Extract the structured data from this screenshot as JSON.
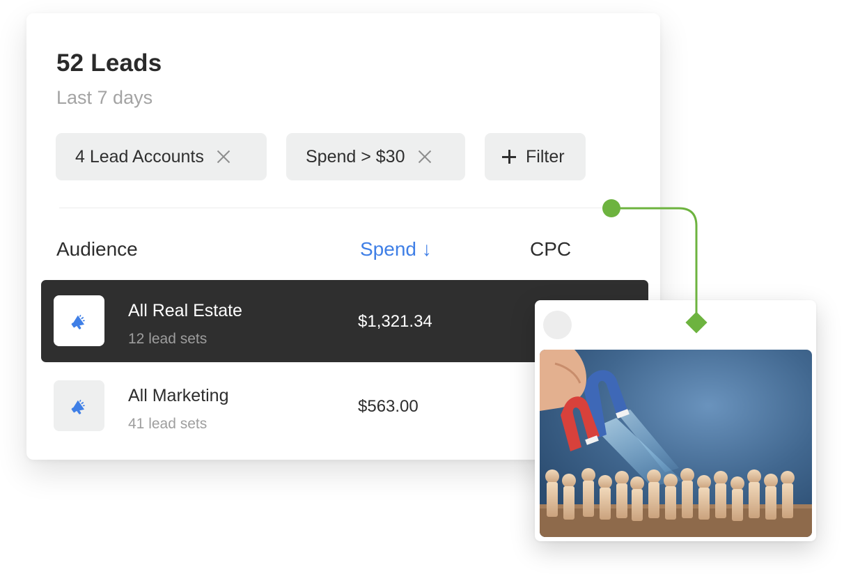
{
  "header": {
    "title": "52 Leads",
    "subtitle": "Last 7 days"
  },
  "filters": {
    "chips": [
      {
        "label": "4 Lead Accounts"
      },
      {
        "label": "Spend > $30"
      }
    ],
    "add_label": "Filter"
  },
  "table": {
    "columns": {
      "audience": "Audience",
      "spend": "Spend ↓",
      "cpc": "CPC"
    },
    "rows": [
      {
        "name": "All Real Estate",
        "sets": "12 lead sets",
        "spend": "$1,321.34"
      },
      {
        "name": "All Marketing",
        "sets": "41 lead sets",
        "spend": "$563.00"
      }
    ]
  },
  "icons": {
    "row_icon": "megaphone-icon",
    "remove_icon": "close-icon",
    "add_icon": "plus-icon"
  },
  "colors": {
    "accent_blue": "#3f7fe6",
    "connector_green": "#6db33f",
    "active_row": "#2f2f2f",
    "chip_bg": "#eeefef"
  }
}
